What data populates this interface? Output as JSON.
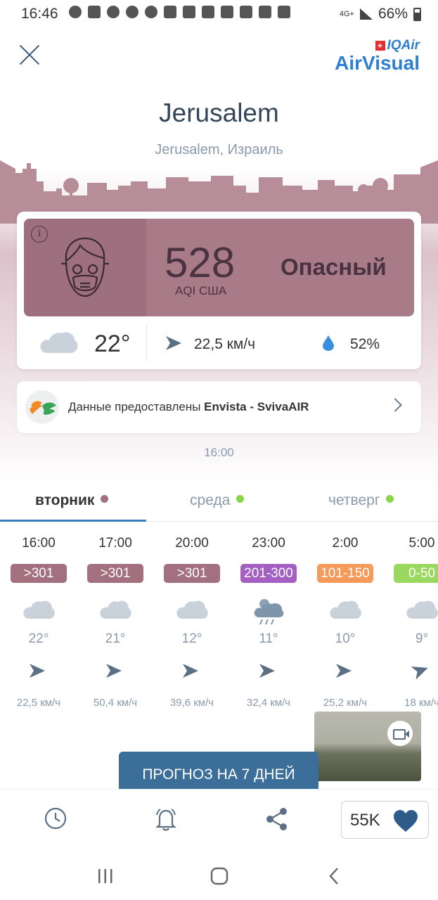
{
  "status_bar": {
    "time": "16:46",
    "network": "4G+",
    "battery": "66%"
  },
  "header": {
    "logo_top": "IQAir",
    "logo_flag": "+",
    "logo_main": "AirVisual",
    "city": "Jerusalem",
    "location": "Jerusalem, Израиль"
  },
  "aqi": {
    "info": "i",
    "value": "528",
    "label": "AQI США",
    "status": "Опасный",
    "color": "#a97b89"
  },
  "weather": {
    "temperature": "22°",
    "wind": "22,5 км/ч",
    "humidity": "52%"
  },
  "provider": {
    "prefix": "Данные предоставлены ",
    "name": "Envista - SvivaAIR"
  },
  "updated_time": "16:00",
  "day_tabs": [
    {
      "label": "вторник",
      "dot_color": "#a3707f",
      "active": true
    },
    {
      "label": "среда",
      "dot_color": "#8bd44a",
      "active": false
    },
    {
      "label": "четверг",
      "dot_color": "#8bd44a",
      "active": false
    }
  ],
  "hourly": [
    {
      "time": "16:00",
      "aqi": ">301",
      "aqi_color": "#a3707f",
      "icon": "cloud-icon",
      "temp": "22°",
      "wind": "22,5 км/ч"
    },
    {
      "time": "17:00",
      "aqi": ">301",
      "aqi_color": "#a3707f",
      "icon": "cloud-icon",
      "temp": "21°",
      "wind": "50,4 км/ч"
    },
    {
      "time": "20:00",
      "aqi": ">301",
      "aqi_color": "#a3707f",
      "icon": "cloud-icon",
      "temp": "12°",
      "wind": "39,6 км/ч"
    },
    {
      "time": "23:00",
      "aqi": "201-300",
      "aqi_color": "#a35fc2",
      "icon": "night-rain-icon",
      "temp": "11°",
      "wind": "32,4 км/ч"
    },
    {
      "time": "2:00",
      "aqi": "101-150",
      "aqi_color": "#f59a5a",
      "icon": "cloud-icon",
      "temp": "10°",
      "wind": "25,2 км/ч"
    },
    {
      "time": "5:00",
      "aqi": "0-50",
      "aqi_color": "#9bd85f",
      "icon": "cloud-icon",
      "temp": "9°",
      "wind": "18 км/ч"
    }
  ],
  "forecast_button": "ПРОГНОЗ НА 7 ДНЕЙ",
  "bottom_bar": {
    "likes": "55K"
  }
}
